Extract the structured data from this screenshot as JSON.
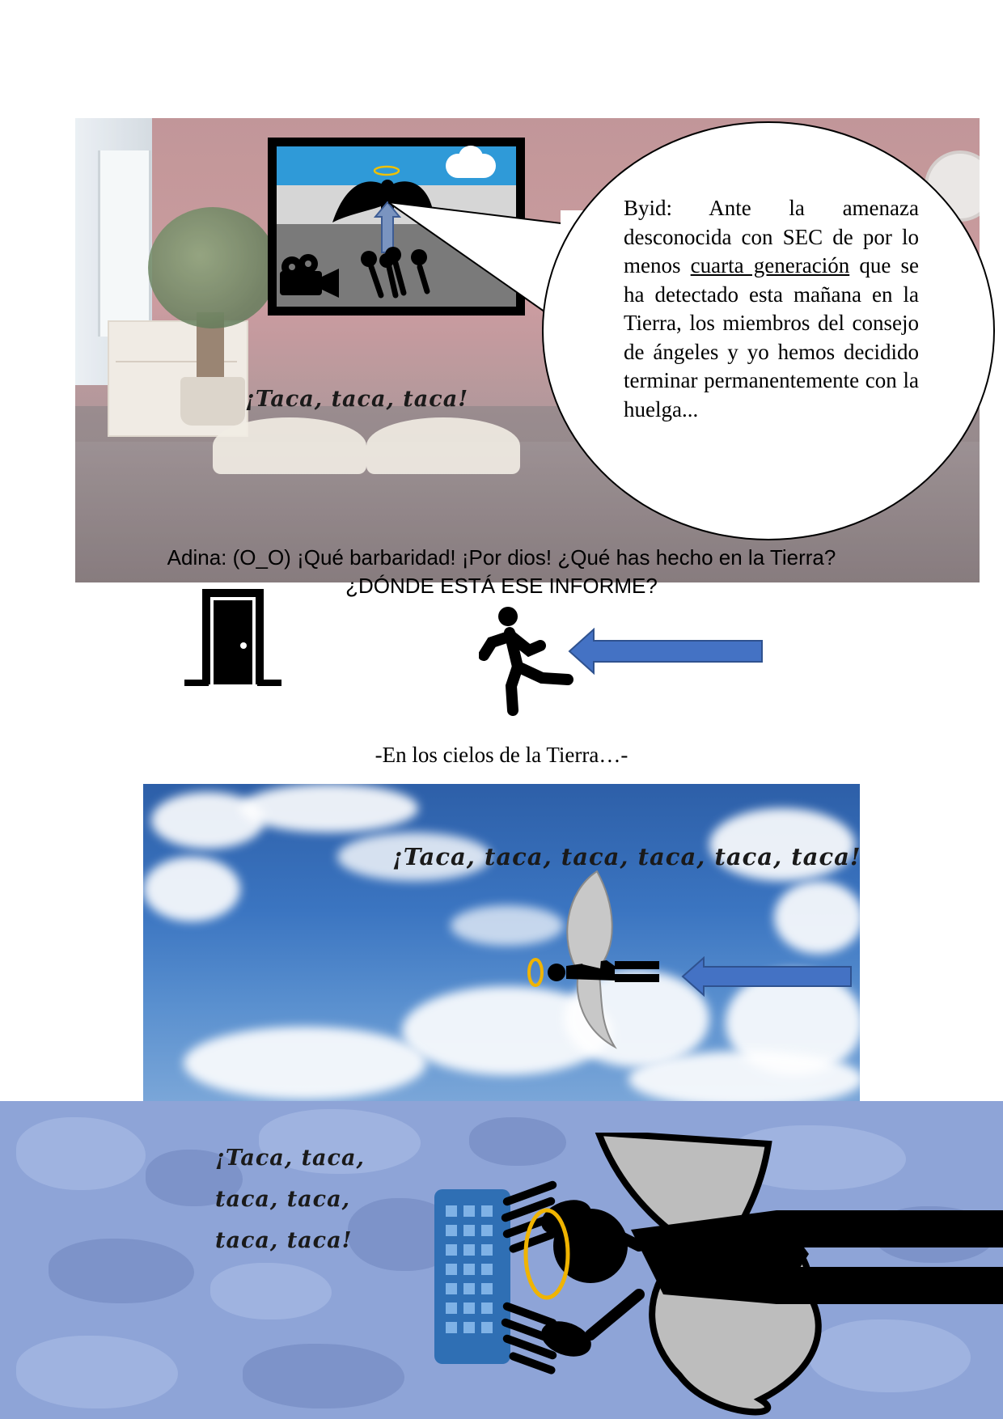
{
  "panel1": {
    "speech_bubble": {
      "before_underline": "Byid: Ante la amenaza desconocida con SEC de por lo menos ",
      "underlined": "cuarta generación",
      "after_underline": " que se ha detectado esta mañana en la Tierra, los miembros del consejo de ángeles y yo hemos decidido terminar permanentemente con la huelga..."
    },
    "sound_effect": "¡Taca, taca, taca!",
    "dialogue_line1": "Adina: (O_O) ¡Qué barbaridad! ¡Por dios! ¿Qué has hecho en la Tierra?",
    "dialogue_line2": "¿DÓNDE ESTÁ ESE INFORME?"
  },
  "middle": {
    "icons": [
      "door-icon",
      "running-person-icon",
      "arrow-left-icon"
    ],
    "caption": "-En los cielos de la Tierra…-"
  },
  "panel2": {
    "sound_effect": "¡Taca, taca, taca, taca, taca, taca!",
    "icons": [
      "halo-icon",
      "winged-angel-icon",
      "arrow-left-icon"
    ]
  },
  "panel3": {
    "sound_effect_line1": "¡Taca, taca,",
    "sound_effect_line2": "taca, taca,",
    "sound_effect_line3": "taca, taca!",
    "icons": [
      "keyboard-icon",
      "hand-icon",
      "halo-icon",
      "angel-icon"
    ]
  },
  "colors": {
    "arrow_blue": "#4472c4",
    "halo_gold": "#f0b400",
    "wing_gray": "#bdbdbd",
    "tv_sky_blue": "#2f9ad8",
    "camo_blue": "#8ea4d7"
  }
}
